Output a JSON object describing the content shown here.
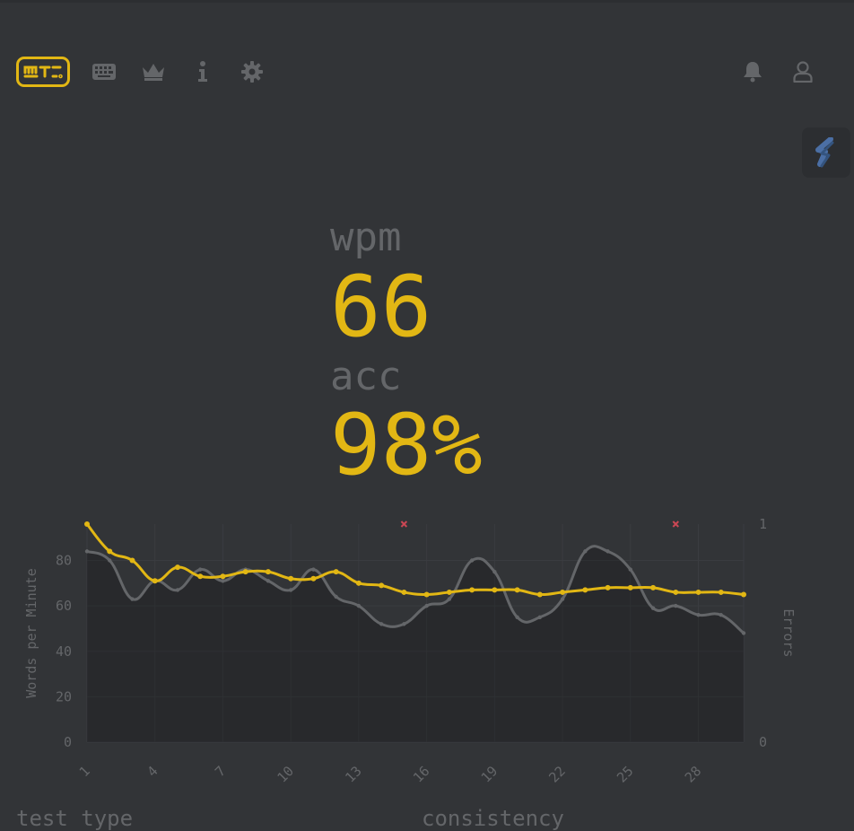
{
  "nav": {
    "logo": "monkeytype-logo",
    "left_icons": [
      "keyboard-icon",
      "crown-icon",
      "info-icon",
      "gear-icon"
    ],
    "right_icons": [
      "bell-icon",
      "user-icon"
    ]
  },
  "colors": {
    "background": "#323437",
    "accent": "#e2b714",
    "text_muted": "#646669",
    "raw_line": "#646669",
    "error_mark": "#ca4754"
  },
  "stats": {
    "wpm_label": "wpm",
    "wpm_value": "66",
    "acc_label": "acc",
    "acc_value": "98%"
  },
  "chart_data": {
    "type": "line",
    "x": [
      1,
      2,
      3,
      4,
      5,
      6,
      7,
      8,
      9,
      10,
      11,
      12,
      13,
      14,
      15,
      16,
      17,
      18,
      19,
      20,
      21,
      22,
      23,
      24,
      25,
      26,
      27,
      28,
      29,
      30
    ],
    "x_ticks": [
      "1",
      "4",
      "7",
      "10",
      "13",
      "16",
      "19",
      "22",
      "25",
      "28"
    ],
    "ylabel": "Words per Minute",
    "ylim": [
      0,
      96
    ],
    "y_ticks": [
      "0",
      "20",
      "40",
      "60",
      "80"
    ],
    "y2label": "Errors",
    "y2lim": [
      0,
      1
    ],
    "y2_ticks": [
      "0",
      "1"
    ],
    "grid": true,
    "series": [
      {
        "name": "",
        "color": "#e2b714",
        "values": [
          96,
          84,
          80,
          71,
          77,
          73,
          73,
          75,
          75,
          72,
          72,
          75,
          70,
          69,
          66,
          65,
          66,
          67,
          67,
          67,
          65,
          66,
          67,
          68,
          68,
          68,
          66,
          66,
          66,
          65
        ]
      },
      {
        "name": "",
        "color": "#646669",
        "values": [
          84,
          80,
          63,
          71,
          67,
          76,
          71,
          76,
          71,
          67,
          76,
          64,
          60,
          52,
          52,
          60,
          63,
          80,
          75,
          55,
          55,
          63,
          84,
          84,
          76,
          59,
          60,
          56,
          56,
          48
        ]
      }
    ],
    "errors": [
      {
        "x": 15,
        "count": 1
      },
      {
        "x": 27,
        "count": 1
      }
    ]
  },
  "bottom": {
    "test_type_label": "test type",
    "consistency_label": "consistency"
  }
}
